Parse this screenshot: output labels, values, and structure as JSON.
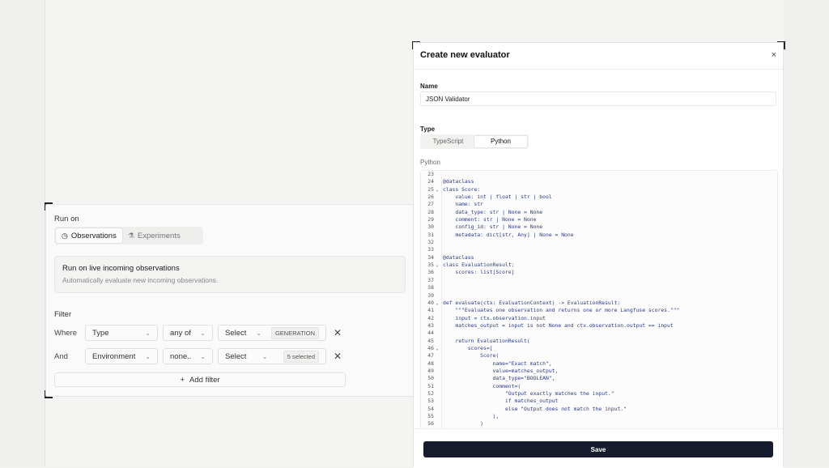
{
  "run_on": {
    "title": "Run on",
    "tabs": [
      {
        "label": "Observations",
        "icon": "clock-icon"
      },
      {
        "label": "Experiments",
        "icon": "flask-icon"
      }
    ],
    "info_title": "Run on live incoming observations",
    "info_subtitle": "Automatically evaluate new incoming observations."
  },
  "filter": {
    "title": "Filter",
    "rows": [
      {
        "conj": "Where",
        "field": "Type",
        "op": "any of",
        "value": "Select",
        "tag": "GENERATION"
      },
      {
        "conj": "And",
        "field": "Environment",
        "op": "none..",
        "value": "Select",
        "tag": "5 selected"
      }
    ],
    "add_label": "Add filter"
  },
  "dialog": {
    "title": "Create new evaluator",
    "close": "×",
    "name_label": "Name",
    "name_value": "JSON Validator",
    "type_label": "Type",
    "type_tabs": [
      "TypeScript",
      "Python"
    ],
    "code_label": "Python",
    "save_label": "Save"
  },
  "code_lines": [
    {
      "n": "23",
      "f": "",
      "t": ""
    },
    {
      "n": "24",
      "f": "",
      "t": "@dataclass"
    },
    {
      "n": "25",
      "f": "⌄",
      "t": "class Score:"
    },
    {
      "n": "26",
      "f": "",
      "t": "    value: int | float | str | bool"
    },
    {
      "n": "27",
      "f": "",
      "t": "    name: str"
    },
    {
      "n": "28",
      "f": "",
      "t": "    data_type: str | None = None"
    },
    {
      "n": "29",
      "f": "",
      "t": "    comment: str | None = None"
    },
    {
      "n": "30",
      "f": "",
      "t": "    config_id: str | None = None"
    },
    {
      "n": "31",
      "f": "",
      "t": "    metadata: dict[str, Any] | None = None"
    },
    {
      "n": "32",
      "f": "",
      "t": ""
    },
    {
      "n": "33",
      "f": "",
      "t": ""
    },
    {
      "n": "34",
      "f": "",
      "t": "@dataclass"
    },
    {
      "n": "35",
      "f": "⌄",
      "t": "class EvaluationResult:"
    },
    {
      "n": "36",
      "f": "",
      "t": "    scores: list[Score]"
    },
    {
      "n": "37",
      "f": "",
      "t": ""
    },
    {
      "n": "38",
      "f": "",
      "t": ""
    },
    {
      "n": "39",
      "f": "",
      "t": ""
    },
    {
      "n": "40",
      "f": "⌄",
      "t": "def evaluate(ctx: EvaluationContext) -> EvaluationResult:"
    },
    {
      "n": "41",
      "f": "",
      "t": "    \"\"\"Evaluates one observation and returns one or more Langfuse scores.\"\"\""
    },
    {
      "n": "42",
      "f": "",
      "t": "    input = ctx.observation.input"
    },
    {
      "n": "43",
      "f": "",
      "t": "    matches_output = input is not None and ctx.observation.output == input"
    },
    {
      "n": "44",
      "f": "",
      "t": ""
    },
    {
      "n": "45",
      "f": "",
      "t": "    return EvaluationResult("
    },
    {
      "n": "46",
      "f": "⌄",
      "t": "        scores=["
    },
    {
      "n": "47",
      "f": "",
      "t": "            Score("
    },
    {
      "n": "48",
      "f": "",
      "t": "                name=\"Exact match\","
    },
    {
      "n": "49",
      "f": "",
      "t": "                value=matches_output,"
    },
    {
      "n": "50",
      "f": "",
      "t": "                data_type=\"BOOLEAN\","
    },
    {
      "n": "51",
      "f": "",
      "t": "                comment=("
    },
    {
      "n": "52",
      "f": "",
      "t": "                    \"Output exactly matches the input.\""
    },
    {
      "n": "53",
      "f": "",
      "t": "                    if matches_output"
    },
    {
      "n": "54",
      "f": "",
      "t": "                    else \"Output does not match the input.\""
    },
    {
      "n": "55",
      "f": "",
      "t": "                ),"
    },
    {
      "n": "56",
      "f": "",
      "t": "            )"
    }
  ]
}
